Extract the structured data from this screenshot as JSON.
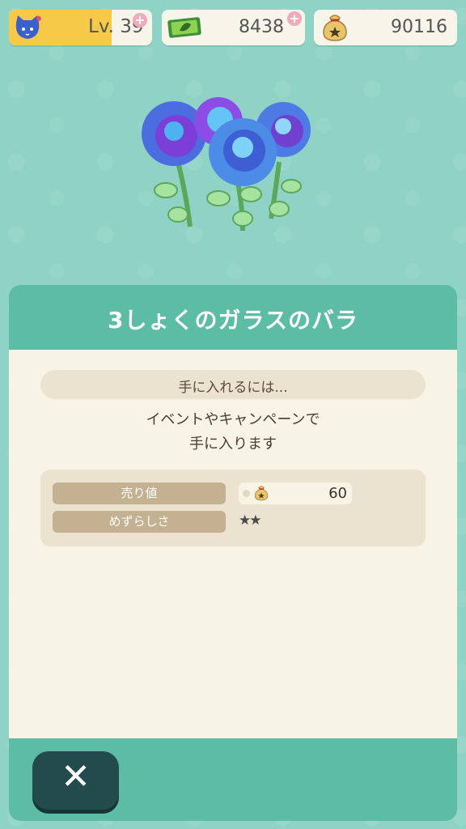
{
  "hud": {
    "level_label": "Lv. 39",
    "level_progress": 0.72,
    "tickets": "8438",
    "bells": "90116"
  },
  "item": {
    "name": "3しょくのガラスのバラ",
    "how_to_get_header": "手に入れるには...",
    "description_lines": [
      "イベントやキャンペーンで",
      "手に入ります"
    ],
    "sell_label": "売り値",
    "sell_value": "60",
    "rarity_label": "めずらしさ",
    "rarity_stars": "★★"
  },
  "colors": {
    "background": "#8fd3c6",
    "panel_header": "#5dbca6",
    "panel_body": "#f7f4e6",
    "level_bar": "#f7c948",
    "close_button": "#244b4b"
  },
  "icons": {
    "avatar": "cat-face-icon",
    "level_action": "magnifier-plus-icon",
    "ticket": "leaf-ticket-icon",
    "bells": "bell-bag-icon",
    "close": "close-icon"
  }
}
